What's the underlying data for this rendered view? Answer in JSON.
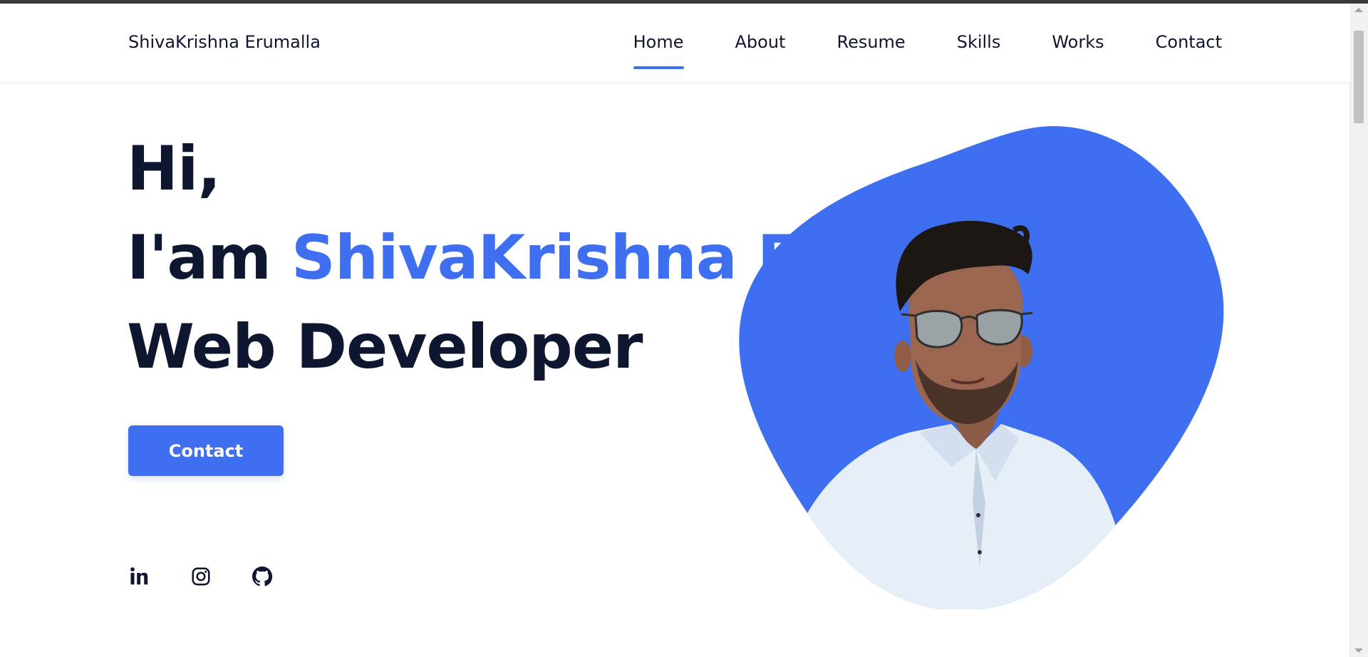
{
  "header": {
    "brand": "ShivaKrishna Erumalla",
    "nav": [
      {
        "label": "Home",
        "active": true
      },
      {
        "label": "About"
      },
      {
        "label": "Resume"
      },
      {
        "label": "Skills"
      },
      {
        "label": "Works"
      },
      {
        "label": "Contact"
      }
    ]
  },
  "hero": {
    "line1": "Hi,",
    "line2_prefix": "I'am ",
    "line2_name": "ShivaKrishna E",
    "line3": "Web Developer",
    "button": "Contact",
    "socials": [
      "linkedin-icon",
      "instagram-icon",
      "github-icon"
    ],
    "image": "portrait-photo"
  },
  "colors": {
    "accent": "#3d6ff0",
    "text": "#0e1630",
    "background": "#ffffff"
  }
}
